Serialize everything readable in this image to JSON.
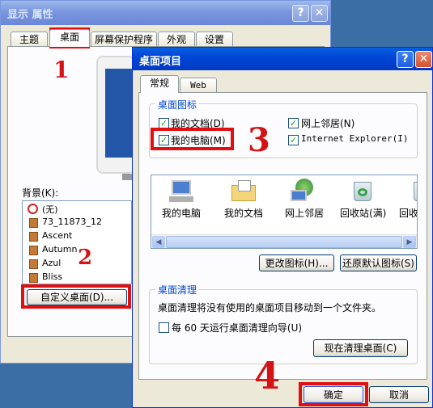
{
  "back_window": {
    "title": "显示 属性",
    "tabs": [
      "主题",
      "桌面",
      "屏幕保护程序",
      "外观",
      "设置"
    ],
    "background_label": "背景(K):",
    "background_items": [
      "(无)",
      "73_11873_12",
      "Ascent",
      "Autumn",
      "Azul",
      "Bliss"
    ],
    "customize_button": "自定义桌面(D)..."
  },
  "dialog": {
    "title": "桌面项目",
    "tabs": [
      "常规",
      "Web"
    ],
    "icons_group_title": "桌面图标",
    "checkboxes": [
      {
        "label": "我的文档(D)",
        "checked": true
      },
      {
        "label": "网上邻居(N)",
        "checked": true
      },
      {
        "label": "我的电脑(M)",
        "checked": true
      },
      {
        "label": "Internet Explorer(I)",
        "checked": true
      }
    ],
    "icon_items": [
      "我的电脑",
      "我的文档",
      "网上邻居",
      "回收站(满)",
      "回收"
    ],
    "change_icon_button": "更改图标(H)...",
    "restore_default_button": "还原默认图标(S)",
    "cleanup_group_title": "桌面清理",
    "cleanup_text": "桌面清理将没有使用的桌面项目移动到一个文件夹。",
    "cleanup_checkbox": {
      "label": "每 60 天运行桌面清理向导(U)",
      "checked": false
    },
    "cleanup_now_button": "现在清理桌面(C)",
    "ok_button": "确定",
    "cancel_button": "取消"
  },
  "annotations": [
    "1",
    "2",
    "3",
    "4"
  ],
  "colors": {
    "annotation": "#e01010",
    "titlebar": "#0046d5",
    "dialog_face": "#ece9d8"
  }
}
